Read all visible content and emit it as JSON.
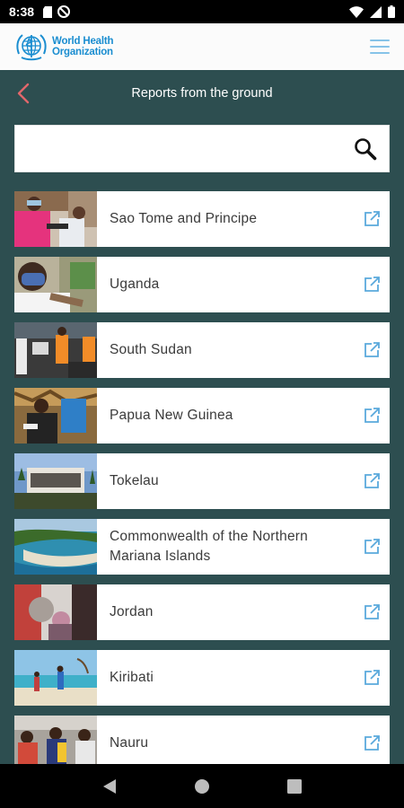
{
  "status_bar": {
    "time": "8:38"
  },
  "header": {
    "logo_line1": "World Health",
    "logo_line2": "Organization"
  },
  "page": {
    "title": "Reports from the ground"
  },
  "search": {
    "value": "",
    "placeholder": ""
  },
  "countries": [
    {
      "name": "Sao Tome and Principe"
    },
    {
      "name": "Uganda"
    },
    {
      "name": "South Sudan"
    },
    {
      "name": "Papua New Guinea"
    },
    {
      "name": "Tokelau"
    },
    {
      "name": "Commonwealth of the Northern Mariana Islands"
    },
    {
      "name": "Jordan"
    },
    {
      "name": "Kiribati"
    },
    {
      "name": "Nauru"
    }
  ],
  "colors": {
    "teal_bg": "#2d4e50",
    "who_blue": "#1a8dd0",
    "back_arrow": "#e0676b",
    "link_icon": "#5aa9dc"
  }
}
